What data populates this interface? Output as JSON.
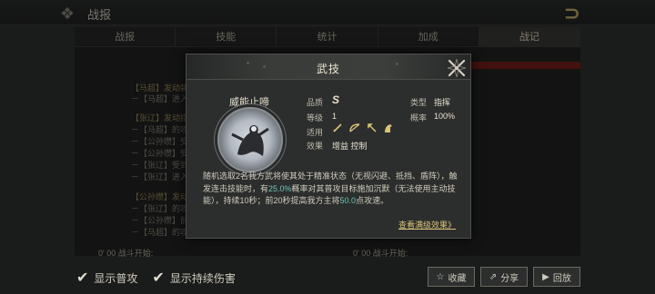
{
  "app": {
    "title": "战报"
  },
  "tabs": [
    {
      "label": "战报",
      "active": false
    },
    {
      "label": "技能",
      "active": false
    },
    {
      "label": "统计",
      "active": false
    },
    {
      "label": "加成",
      "active": false
    },
    {
      "label": "战记",
      "active": true
    }
  ],
  "log": {
    "lines": [
      "【马超】发动装",
      "－【马超】进入",
      "【张辽】发动指",
      "－【马超】的攻",
      "－【公孙瓒】受",
      "－【公孙瓒】受",
      "－【张辽】受到",
      "－【张辽】进入",
      "【公孙瓒】发动",
      "－【张辽】的攻",
      "－【公孙瓒】前",
      "－【马超】的攻"
    ],
    "left_time": "0'  00  战斗开始:",
    "right_time": "0'  00  战斗开始:"
  },
  "footer": {
    "show_normal_attack": "显示普攻",
    "show_continuous_damage": "显示持续伤害",
    "buttons": [
      {
        "label": "收藏",
        "icon": "star-icon"
      },
      {
        "label": "分享",
        "icon": "share-icon"
      },
      {
        "label": "回放",
        "icon": "play-icon"
      }
    ]
  },
  "modal": {
    "title": "武技",
    "skill_name": "威能止啼",
    "attributes": {
      "quality_label": "品质",
      "quality_value": "S",
      "type_label": "类型",
      "type_value": "指挥",
      "level_label": "等级",
      "level_value": "1",
      "rate_label": "概率",
      "rate_value": "100%",
      "applicable_label": "适用",
      "applicable_icons": [
        "sword-icon",
        "bow-icon",
        "spear-icon",
        "horse-icon"
      ],
      "effect_label": "效果",
      "effect_value": "增益  控制"
    },
    "description": {
      "part1": "随机选取2名我方武将使其处于精准状态（无视闪避、抵挡、盾阵），触发连击技能时，有",
      "pct1": "25.0%",
      "part2": "概率对其普攻目标施加沉默（无法使用主动技能），持续10秒；前20秒提高我方主将",
      "pct2": "50.0",
      "part3": "点攻速。"
    },
    "more_link": "查看满级效果》"
  },
  "colors": {
    "accent_gold": "#d9c27a",
    "highlight_teal": "#6ec4b6",
    "alert_red": "#7a1f1c"
  }
}
